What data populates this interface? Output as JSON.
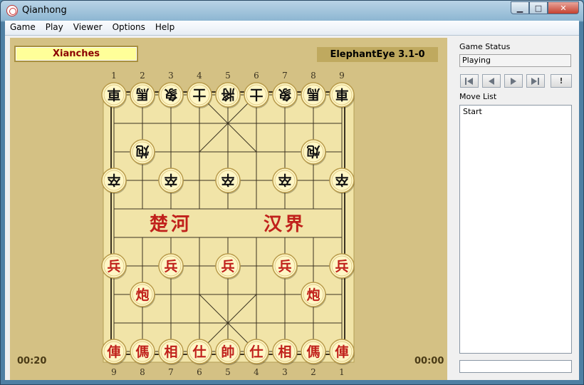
{
  "window": {
    "title": "Qianhong",
    "min_label": "▁",
    "max_label": "□",
    "close_label": "✕"
  },
  "menu": [
    "Game",
    "Play",
    "Viewer",
    "Options",
    "Help"
  ],
  "board": {
    "player_red": "Xianches",
    "player_black": "ElephantEye 3.1-0",
    "clock_red": "00:20",
    "clock_black": "00:00",
    "top_file_labels": [
      "1",
      "2",
      "3",
      "4",
      "5",
      "6",
      "7",
      "8",
      "9"
    ],
    "bottom_file_labels": [
      "9",
      "8",
      "7",
      "6",
      "5",
      "4",
      "3",
      "2",
      "1"
    ],
    "river_left": "楚河",
    "river_right": "汉界",
    "colors": {
      "red": "#c0201b",
      "black": "#111111",
      "piece_face": "#fff6c6",
      "board": "#d4c184",
      "board_inner": "#f1e4a8"
    },
    "pieces": [
      {
        "side": "black",
        "glyph": "車",
        "col": 0,
        "row": 0,
        "flipped": true
      },
      {
        "side": "black",
        "glyph": "馬",
        "col": 1,
        "row": 0,
        "flipped": true
      },
      {
        "side": "black",
        "glyph": "象",
        "col": 2,
        "row": 0,
        "flipped": true
      },
      {
        "side": "black",
        "glyph": "士",
        "col": 3,
        "row": 0,
        "flipped": true
      },
      {
        "side": "black",
        "glyph": "將",
        "col": 4,
        "row": 0,
        "flipped": true
      },
      {
        "side": "black",
        "glyph": "士",
        "col": 5,
        "row": 0,
        "flipped": true
      },
      {
        "side": "black",
        "glyph": "象",
        "col": 6,
        "row": 0,
        "flipped": true
      },
      {
        "side": "black",
        "glyph": "馬",
        "col": 7,
        "row": 0,
        "flipped": true
      },
      {
        "side": "black",
        "glyph": "車",
        "col": 8,
        "row": 0,
        "flipped": true
      },
      {
        "side": "black",
        "glyph": "炮",
        "col": 1,
        "row": 2,
        "flipped": true
      },
      {
        "side": "black",
        "glyph": "炮",
        "col": 7,
        "row": 2,
        "flipped": true
      },
      {
        "side": "black",
        "glyph": "卒",
        "col": 0,
        "row": 3,
        "flipped": true
      },
      {
        "side": "black",
        "glyph": "卒",
        "col": 2,
        "row": 3,
        "flipped": true
      },
      {
        "side": "black",
        "glyph": "卒",
        "col": 4,
        "row": 3,
        "flipped": true
      },
      {
        "side": "black",
        "glyph": "卒",
        "col": 6,
        "row": 3,
        "flipped": true
      },
      {
        "side": "black",
        "glyph": "卒",
        "col": 8,
        "row": 3,
        "flipped": true
      },
      {
        "side": "red",
        "glyph": "兵",
        "col": 0,
        "row": 6,
        "flipped": false
      },
      {
        "side": "red",
        "glyph": "兵",
        "col": 2,
        "row": 6,
        "flipped": false
      },
      {
        "side": "red",
        "glyph": "兵",
        "col": 4,
        "row": 6,
        "flipped": false
      },
      {
        "side": "red",
        "glyph": "兵",
        "col": 6,
        "row": 6,
        "flipped": false
      },
      {
        "side": "red",
        "glyph": "兵",
        "col": 8,
        "row": 6,
        "flipped": false
      },
      {
        "side": "red",
        "glyph": "炮",
        "col": 1,
        "row": 7,
        "flipped": false
      },
      {
        "side": "red",
        "glyph": "炮",
        "col": 7,
        "row": 7,
        "flipped": false
      },
      {
        "side": "red",
        "glyph": "俥",
        "col": 0,
        "row": 9,
        "flipped": false
      },
      {
        "side": "red",
        "glyph": "傌",
        "col": 1,
        "row": 9,
        "flipped": false
      },
      {
        "side": "red",
        "glyph": "相",
        "col": 2,
        "row": 9,
        "flipped": false
      },
      {
        "side": "red",
        "glyph": "仕",
        "col": 3,
        "row": 9,
        "flipped": false
      },
      {
        "side": "red",
        "glyph": "帥",
        "col": 4,
        "row": 9,
        "flipped": false
      },
      {
        "side": "red",
        "glyph": "仕",
        "col": 5,
        "row": 9,
        "flipped": false
      },
      {
        "side": "red",
        "glyph": "相",
        "col": 6,
        "row": 9,
        "flipped": false
      },
      {
        "side": "red",
        "glyph": "傌",
        "col": 7,
        "row": 9,
        "flipped": false
      },
      {
        "side": "red",
        "glyph": "俥",
        "col": 8,
        "row": 9,
        "flipped": false
      }
    ]
  },
  "sidebar": {
    "status_label": "Game Status",
    "status_value": "Playing",
    "nav_buttons": [
      {
        "name": "first-move-button",
        "icon": "first-icon"
      },
      {
        "name": "prev-move-button",
        "icon": "prev-icon"
      },
      {
        "name": "next-move-button",
        "icon": "next-icon"
      },
      {
        "name": "last-move-button",
        "icon": "last-icon"
      }
    ],
    "hint_label": "!",
    "movelist_label": "Move List",
    "moves": [
      "Start"
    ]
  }
}
